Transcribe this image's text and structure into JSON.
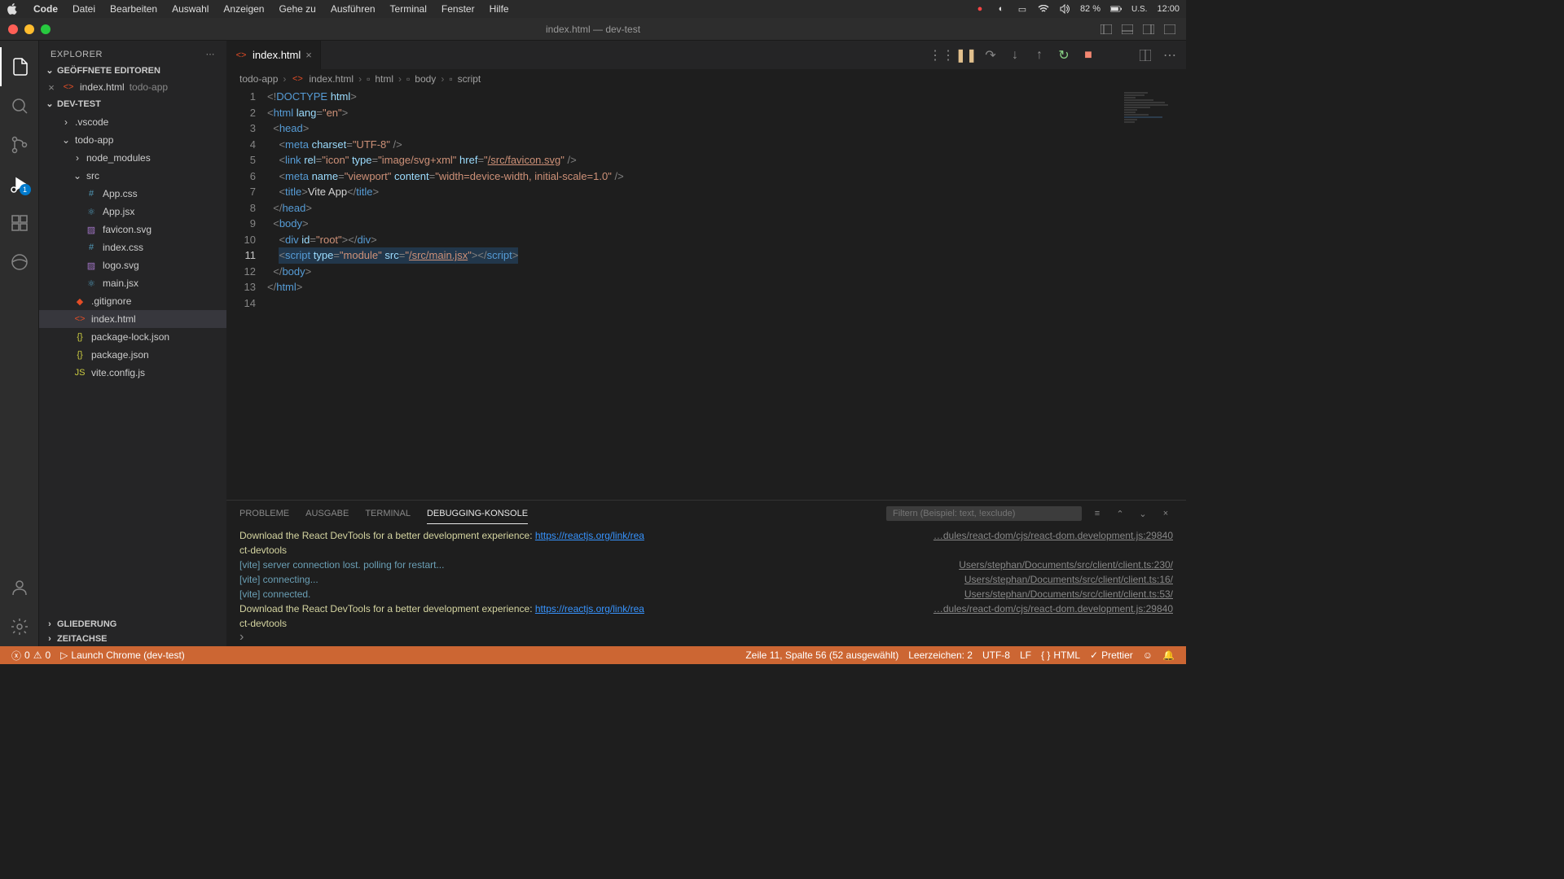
{
  "menubar": {
    "app": "Code",
    "items": [
      "Datei",
      "Bearbeiten",
      "Auswahl",
      "Anzeigen",
      "Gehe zu",
      "Ausführen",
      "Terminal",
      "Fenster",
      "Hilfe"
    ],
    "battery": "82 %",
    "input": "U.S.",
    "time": "12:00"
  },
  "window": {
    "title": "index.html — dev-test"
  },
  "activity": {
    "debug_badge": "1"
  },
  "sidebar": {
    "title": "EXPLORER",
    "open_editors": "GEÖFFNETE EDITOREN",
    "workspace": "DEV-TEST",
    "open_file": {
      "name": "index.html",
      "dir": "todo-app"
    },
    "folders": {
      "vscode": ".vscode",
      "todoapp": "todo-app",
      "node_modules": "node_modules",
      "src": "src"
    },
    "files": {
      "appcss": "App.css",
      "appjsx": "App.jsx",
      "favicon": "favicon.svg",
      "indexcss": "index.css",
      "logosvg": "logo.svg",
      "mainjsx": "main.jsx",
      "gitignore": ".gitignore",
      "indexhtml": "index.html",
      "pkglock": "package-lock.json",
      "pkg": "package.json",
      "vite": "vite.config.js"
    },
    "sections": {
      "outline": "GLIEDERUNG",
      "timeline": "ZEITACHSE"
    }
  },
  "tab": {
    "name": "index.html"
  },
  "breadcrumb": [
    "todo-app",
    "index.html",
    "html",
    "body",
    "script"
  ],
  "code": {
    "lines": [
      "1",
      "2",
      "3",
      "4",
      "5",
      "6",
      "7",
      "8",
      "9",
      "10",
      "11",
      "12",
      "13",
      "14"
    ]
  },
  "panel": {
    "tabs": {
      "problems": "PROBLEME",
      "output": "AUSGABE",
      "terminal": "TERMINAL",
      "debug": "DEBUGGING-KONSOLE"
    },
    "filter_placeholder": "Filtern (Beispiel: text, !exclude)",
    "lines": [
      {
        "msg1": "Download the React DevTools for a better development experience: ",
        "link": "https://reactjs.org/link/rea",
        "src": "…dules/react-dom/cjs/react-dom.development.js:29840"
      },
      {
        "msg1": "ct-devtools",
        "src": ""
      },
      {
        "msg1": "[vite] server connection lost. polling for restart...",
        "src": "Users/stephan/Documents/src/client/client.ts:230/"
      },
      {
        "msg1": "[vite] connecting...",
        "src": "Users/stephan/Documents/src/client/client.ts:16/"
      },
      {
        "msg1": "[vite] connected.",
        "src": "Users/stephan/Documents/src/client/client.ts:53/"
      },
      {
        "msg1": "Download the React DevTools for a better development experience: ",
        "link": "https://reactjs.org/link/rea",
        "src": "…dules/react-dom/cjs/react-dom.development.js:29840"
      },
      {
        "msg1": "ct-devtools",
        "src": ""
      }
    ]
  },
  "statusbar": {
    "errors": "0",
    "warnings": "0",
    "launch": "Launch Chrome (dev-test)",
    "cursor": "Zeile 11, Spalte 56 (52 ausgewählt)",
    "spaces": "Leerzeichen: 2",
    "encoding": "UTF-8",
    "eol": "LF",
    "lang": "HTML",
    "prettier": "Prettier"
  }
}
